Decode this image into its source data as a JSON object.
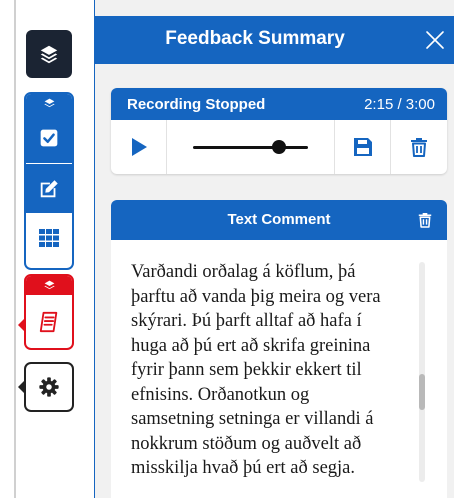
{
  "colors": {
    "accent": "#1565c0",
    "alert": "#e0101c",
    "dark": "#1b2433",
    "panel_bg": "#f1f1f1"
  },
  "toolbar": {
    "items": [
      {
        "name": "layers-button",
        "icon": "layers-icon",
        "active": true
      },
      {
        "name": "checkbox-tool",
        "icon": "checkbox-icon",
        "group": "blue",
        "active": true
      },
      {
        "name": "edit-comment-tool",
        "icon": "edit-icon",
        "group": "blue",
        "active": true
      },
      {
        "name": "grid-tool",
        "icon": "grid-icon",
        "group": "blue",
        "active": false
      },
      {
        "name": "feedback-summary-tool",
        "icon": "notepad-icon",
        "group": "red",
        "active": true
      },
      {
        "name": "settings-button",
        "icon": "gear-icon",
        "active": false
      }
    ]
  },
  "panel": {
    "title": "Feedback Summary",
    "close_icon": "close-icon"
  },
  "recording": {
    "status": "Recording Stopped",
    "time": "2:15 / 3:00",
    "progress": 0.75,
    "controls": [
      "play-icon",
      "save-icon",
      "trash-icon"
    ]
  },
  "comment": {
    "title": "Text Comment",
    "delete_icon": "trash-icon",
    "lines": [
      "Varðandi orðalag á köflum, þá",
      "þarftu að vanda þig meira og vera",
      "skýrari. Þú þarft alltaf að hafa í",
      "huga að þú ert að skrifa greinina",
      "fyrir þann sem þekkir ekkert til",
      "efnisins. Orðanotkun og",
      "samsetning setninga er villandi á",
      "nokkrum stöðum og auðvelt að",
      "misskilja hvað þú ert að segja."
    ]
  }
}
